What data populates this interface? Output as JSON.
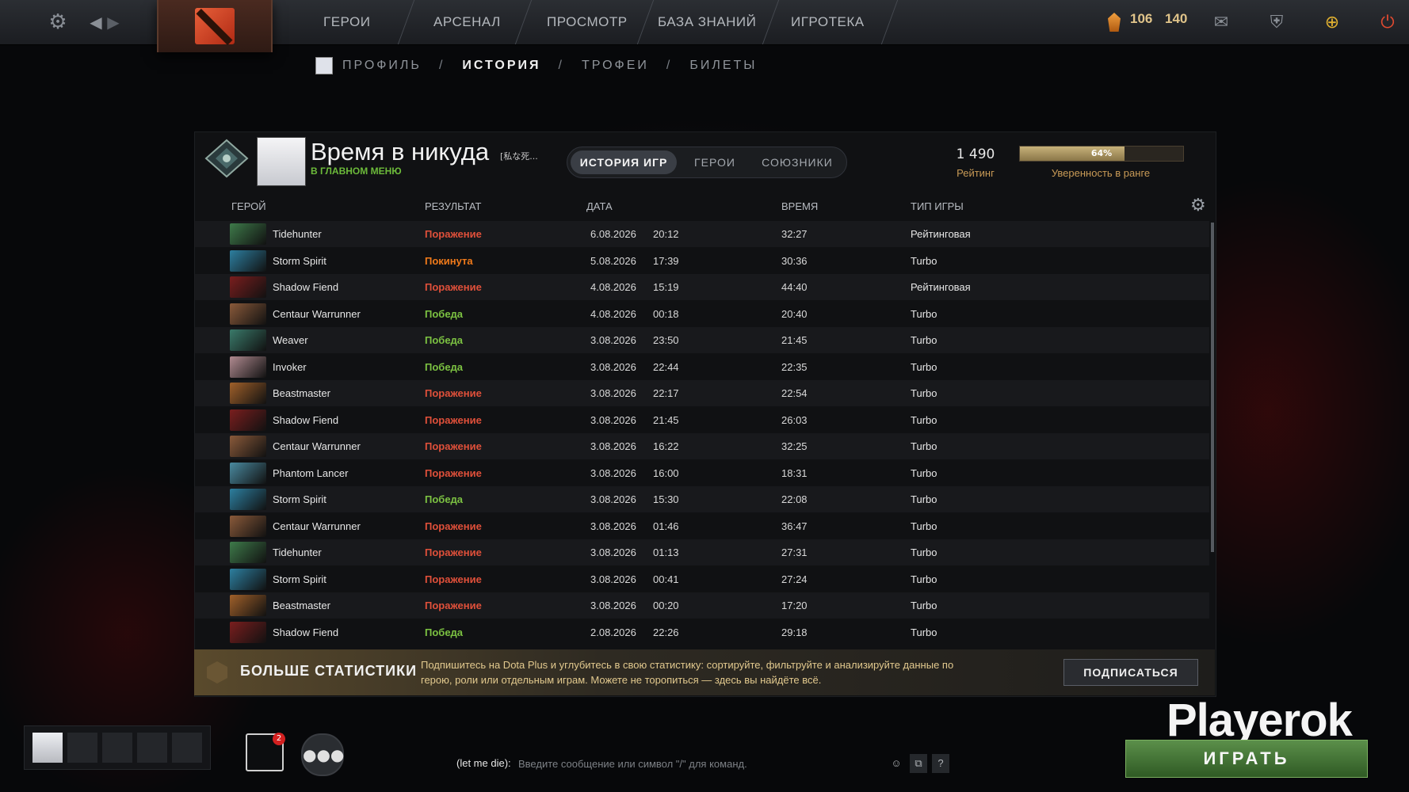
{
  "topbar": {
    "nav": [
      "ГЕРОИ",
      "АРСЕНАЛ",
      "ПРОСМОТР",
      "БАЗА ЗНАНИЙ",
      "ИГРОТЕКА"
    ],
    "shards": "106",
    "level": "140"
  },
  "breadcrumb": [
    "ПРОФИЛЬ",
    "ИСТОРИЯ",
    "ТРОФЕИ",
    "БИЛЕТЫ"
  ],
  "profile": {
    "name": "Время в никуда",
    "tag": "[私な死...",
    "status": "В ГЛАВНОМ МЕНЮ",
    "tabs": [
      "ИСТОРИЯ ИГР",
      "ГЕРОИ",
      "СОЮЗНИКИ"
    ],
    "rating": "1 490",
    "rating_label": "Рейтинг",
    "confidence_percent": 64,
    "confidence_text": "64%",
    "confidence_label": "Уверенность в ранге"
  },
  "table": {
    "headers": [
      "ГЕРОЙ",
      "РЕЗУЛЬТАТ",
      "ДАТА",
      "ВРЕМЯ",
      "ТИП ИГРЫ"
    ],
    "rows": [
      {
        "hero": "Tidehunter",
        "result": "Поражение",
        "date": "6.08.2026",
        "time": "20:12",
        "duration": "32:27",
        "type": "Рейтинговая"
      },
      {
        "hero": "Storm Spirit",
        "result": "Покинута",
        "date": "5.08.2026",
        "time": "17:39",
        "duration": "30:36",
        "type": "Turbo"
      },
      {
        "hero": "Shadow Fiend",
        "result": "Поражение",
        "date": "4.08.2026",
        "time": "15:19",
        "duration": "44:40",
        "type": "Рейтинговая"
      },
      {
        "hero": "Centaur Warrunner",
        "result": "Победа",
        "date": "4.08.2026",
        "time": "00:18",
        "duration": "20:40",
        "type": "Turbo"
      },
      {
        "hero": "Weaver",
        "result": "Победа",
        "date": "3.08.2026",
        "time": "23:50",
        "duration": "21:45",
        "type": "Turbo"
      },
      {
        "hero": "Invoker",
        "result": "Победа",
        "date": "3.08.2026",
        "time": "22:44",
        "duration": "22:35",
        "type": "Turbo"
      },
      {
        "hero": "Beastmaster",
        "result": "Поражение",
        "date": "3.08.2026",
        "time": "22:17",
        "duration": "22:54",
        "type": "Turbo"
      },
      {
        "hero": "Shadow Fiend",
        "result": "Поражение",
        "date": "3.08.2026",
        "time": "21:45",
        "duration": "26:03",
        "type": "Turbo"
      },
      {
        "hero": "Centaur Warrunner",
        "result": "Поражение",
        "date": "3.08.2026",
        "time": "16:22",
        "duration": "32:25",
        "type": "Turbo"
      },
      {
        "hero": "Phantom Lancer",
        "result": "Поражение",
        "date": "3.08.2026",
        "time": "16:00",
        "duration": "18:31",
        "type": "Turbo"
      },
      {
        "hero": "Storm Spirit",
        "result": "Победа",
        "date": "3.08.2026",
        "time": "15:30",
        "duration": "22:08",
        "type": "Turbo"
      },
      {
        "hero": "Centaur Warrunner",
        "result": "Поражение",
        "date": "3.08.2026",
        "time": "01:46",
        "duration": "36:47",
        "type": "Turbo"
      },
      {
        "hero": "Tidehunter",
        "result": "Поражение",
        "date": "3.08.2026",
        "time": "01:13",
        "duration": "27:31",
        "type": "Turbo"
      },
      {
        "hero": "Storm Spirit",
        "result": "Поражение",
        "date": "3.08.2026",
        "time": "00:41",
        "duration": "27:24",
        "type": "Turbo"
      },
      {
        "hero": "Beastmaster",
        "result": "Поражение",
        "date": "3.08.2026",
        "time": "00:20",
        "duration": "17:20",
        "type": "Turbo"
      },
      {
        "hero": "Shadow Fiend",
        "result": "Победа",
        "date": "2.08.2026",
        "time": "22:26",
        "duration": "29:18",
        "type": "Turbo"
      }
    ]
  },
  "colors": {
    "loss": "#e0503a",
    "abandon": "#f07a1a",
    "win": "#7cc242",
    "hero_icons": {
      "Tidehunter": "#3e7a4a",
      "Storm Spirit": "#2d7fa0",
      "Shadow Fiend": "#7a1e1e",
      "Centaur Warrunner": "#8a5a3a",
      "Weaver": "#3a7a6a",
      "Invoker": "#b08a90",
      "Beastmaster": "#a0602a",
      "Phantom Lancer": "#4a8aa0"
    }
  },
  "dota_plus": {
    "title": "БОЛЬШЕ СТАТИСТИКИ",
    "description": "Подпишитесь на Dota Plus и углубитесь в свою статистику: сортируйте, фильтруйте и анализируйте данные по герою, роли или отдельным играм. Можете не торопиться — здесь вы найдёте всё.",
    "subscribe": "ПОДПИСАТЬСЯ"
  },
  "bottom": {
    "notifications": "2",
    "chat_prefix": "(let me die):",
    "chat_placeholder": "Введите сообщение или символ \"/\" для команд.",
    "help": "?",
    "play": "ИГРАТЬ",
    "watermark": "Playerok"
  }
}
